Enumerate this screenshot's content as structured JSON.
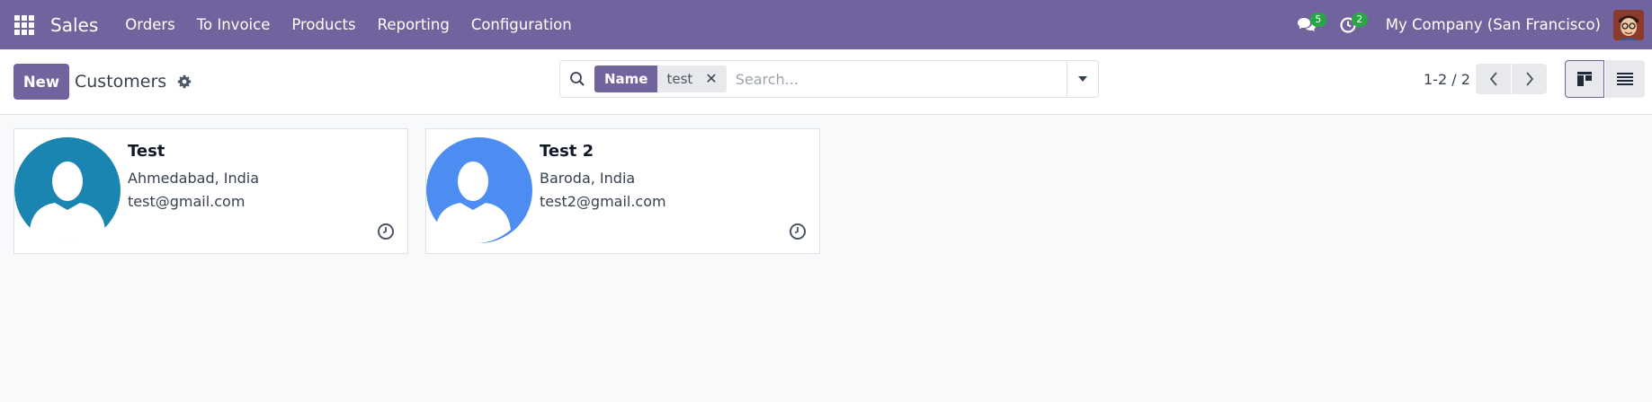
{
  "app": {
    "name": "Sales",
    "menu": [
      "Orders",
      "To Invoice",
      "Products",
      "Reporting",
      "Configuration"
    ]
  },
  "systray": {
    "messages_count": "5",
    "activities_count": "2",
    "company": "My Company (San Francisco)"
  },
  "control_panel": {
    "new_label": "New",
    "title": "Customers",
    "search": {
      "facet_label": "Name",
      "facet_value": "test",
      "placeholder": "Search..."
    },
    "pager": "1-2 / 2"
  },
  "cards": [
    {
      "name": "Test",
      "location": "Ahmedabad, India",
      "email": "test@gmail.com",
      "avatar_color": "#1a85b0"
    },
    {
      "name": "Test 2",
      "location": "Baroda, India",
      "email": "test2@gmail.com",
      "avatar_color": "#4d8cf0"
    }
  ],
  "colors": {
    "brand": "#71639e",
    "badge": "#28a745"
  }
}
